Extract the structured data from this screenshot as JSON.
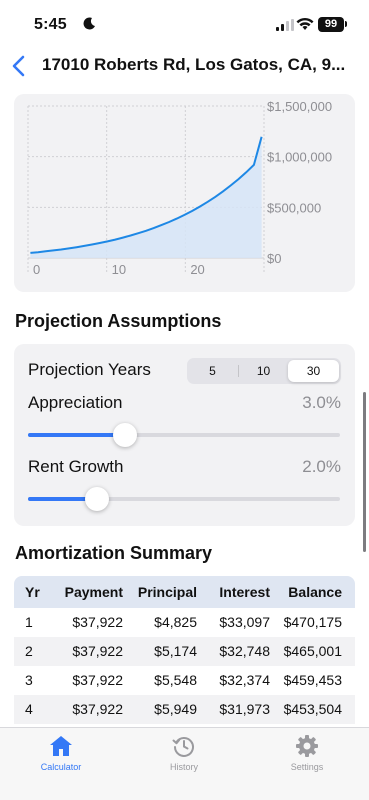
{
  "status": {
    "time": "5:45",
    "battery": "99"
  },
  "nav": {
    "title": "17010 Roberts Rd, Los Gatos, CA, 9..."
  },
  "chart_data": {
    "type": "area",
    "x": [
      0,
      1,
      2,
      3,
      4,
      5,
      6,
      7,
      8,
      9,
      10,
      11,
      12,
      13,
      14,
      15,
      16,
      17,
      18,
      19,
      20,
      21,
      22,
      23,
      24,
      25,
      26,
      27,
      28,
      29,
      30
    ],
    "series": [
      {
        "values": [
          50000,
          57500,
          65700,
          74600,
          84300,
          94900,
          106500,
          119100,
          132800,
          147800,
          164000,
          181700,
          200900,
          221700,
          244300,
          268800,
          295400,
          324200,
          355300,
          389100,
          425700,
          465200,
          508000,
          554200,
          604100,
          658000,
          716000,
          778600,
          846000,
          918600,
          1196000
        ]
      }
    ],
    "xlim": [
      0,
      30
    ],
    "ylim": [
      0,
      1500000
    ],
    "xticks": [
      "0",
      "10",
      "20"
    ],
    "yticks": [
      "$1,500,000",
      "$1,000,000",
      "$500,000",
      "$0"
    ],
    "grid": true
  },
  "assumptions": {
    "title": "Projection Assumptions",
    "projection_years": {
      "label": "Projection Years",
      "options": [
        "5",
        "10",
        "30"
      ],
      "selected": "30"
    },
    "appreciation": {
      "label": "Appreciation",
      "value": "3.0%",
      "level": 0.31
    },
    "rent_growth": {
      "label": "Rent Growth",
      "value": "2.0%",
      "level": 0.22
    }
  },
  "amortization": {
    "title": "Amortization Summary",
    "columns": [
      "Yr",
      "Payment",
      "Principal",
      "Interest",
      "Balance"
    ],
    "rows": [
      [
        "1",
        "$37,922",
        "$4,825",
        "$33,097",
        "$470,175"
      ],
      [
        "2",
        "$37,922",
        "$5,174",
        "$32,748",
        "$465,001"
      ],
      [
        "3",
        "$37,922",
        "$5,548",
        "$32,374",
        "$459,453"
      ],
      [
        "4",
        "$37,922",
        "$5,949",
        "$31,973",
        "$453,504"
      ]
    ]
  },
  "tabs": [
    {
      "label": "Calculator",
      "icon": "house-icon"
    },
    {
      "label": "History",
      "icon": "history-icon"
    },
    {
      "label": "Settings",
      "icon": "gear-icon"
    }
  ],
  "colors": {
    "accent": "#3478f6",
    "chart_fill": "#d6e5f7",
    "chart_line": "#1e88e5"
  }
}
